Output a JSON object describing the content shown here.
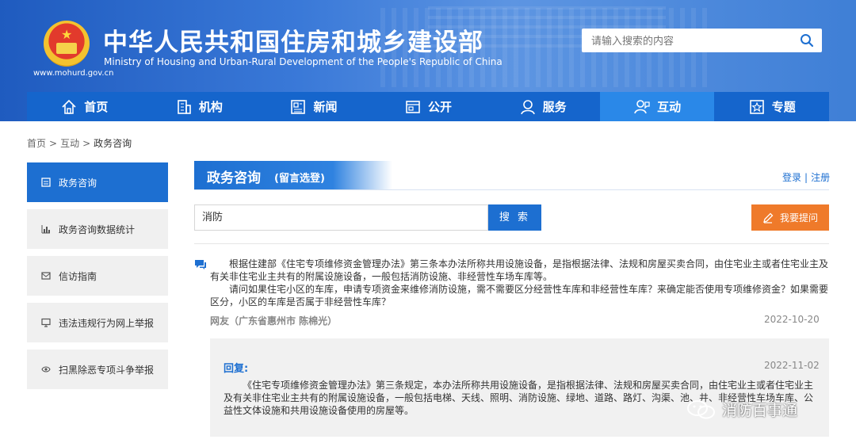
{
  "header": {
    "title_cn": "中华人民共和国住房和城乡建设部",
    "title_en": "Ministry of Housing and Urban-Rural Development of the People's Republic of China",
    "url": "www.mohurd.gov.cn",
    "search_placeholder": "请输入搜索的内容"
  },
  "nav": [
    {
      "label": "首页",
      "icon": "home-icon"
    },
    {
      "label": "机构",
      "icon": "building-icon"
    },
    {
      "label": "新闻",
      "icon": "news-icon"
    },
    {
      "label": "公开",
      "icon": "open-doc-icon"
    },
    {
      "label": "服务",
      "icon": "service-icon"
    },
    {
      "label": "互动",
      "icon": "interact-icon",
      "active": true
    },
    {
      "label": "专题",
      "icon": "topic-icon"
    }
  ],
  "breadcrumb": {
    "home": "首页",
    "sep": ">",
    "section": "互动",
    "current": "政务咨询"
  },
  "sidebar": [
    {
      "label": "政务咨询",
      "icon": "doc-icon",
      "active": true
    },
    {
      "label": "政务咨询数据统计",
      "icon": "chart-icon"
    },
    {
      "label": "信访指南",
      "icon": "mail-icon"
    },
    {
      "label": "违法违规行为网上举报",
      "icon": "monitor-icon"
    },
    {
      "label": "扫黑除恶专项斗争举报",
      "icon": "eye-icon"
    }
  ],
  "main": {
    "section_title": "政务咨询",
    "section_subtitle": "(留言选登)",
    "login": "登录",
    "auth_sep": "|",
    "register": "注册",
    "query_value": "消防",
    "search_button": "搜 索",
    "ask_button": "我要提问"
  },
  "question": {
    "paragraph1": "根据住建部《住宅专项维修资金管理办法》第三条本办法所称共用设施设备，是指根据法律、法规和房屋买卖合同，由住宅业主或者住宅业主及有关非住宅业主共有的附属设施设备，一般包括消防设施、非经营性车场车库等。",
    "paragraph2": "请问如果住宅小区的车库，申请专项资金来维修消防设施，需不需要区分经营性车库和非经营性车库？来确定能否使用专项维修资金？如果需要区分，小区的车库是否属于非经营性车库？",
    "author": "网友（广东省惠州市 陈棉光）",
    "date": "2022-10-20"
  },
  "reply": {
    "label": "回复:",
    "date": "2022-11-02",
    "body": "《住宅专项维修资金管理办法》第三条规定，本办法所称共用设施设备，是指根据法律、法规和房屋买卖合同，由住宅业主或者住宅业主及有关非住宅业主共有的附属设施设备，一般包括电梯、天线、照明、消防设施、绿地、道路、路灯、沟渠、池、井、非经营性车场车库、公益性文体设施和共用设施设备使用的房屋等。"
  },
  "watermark": "消防百事通",
  "colors": {
    "primary": "#1d6fd1",
    "nav": "#1565cc",
    "accent": "#ef7a2a"
  }
}
